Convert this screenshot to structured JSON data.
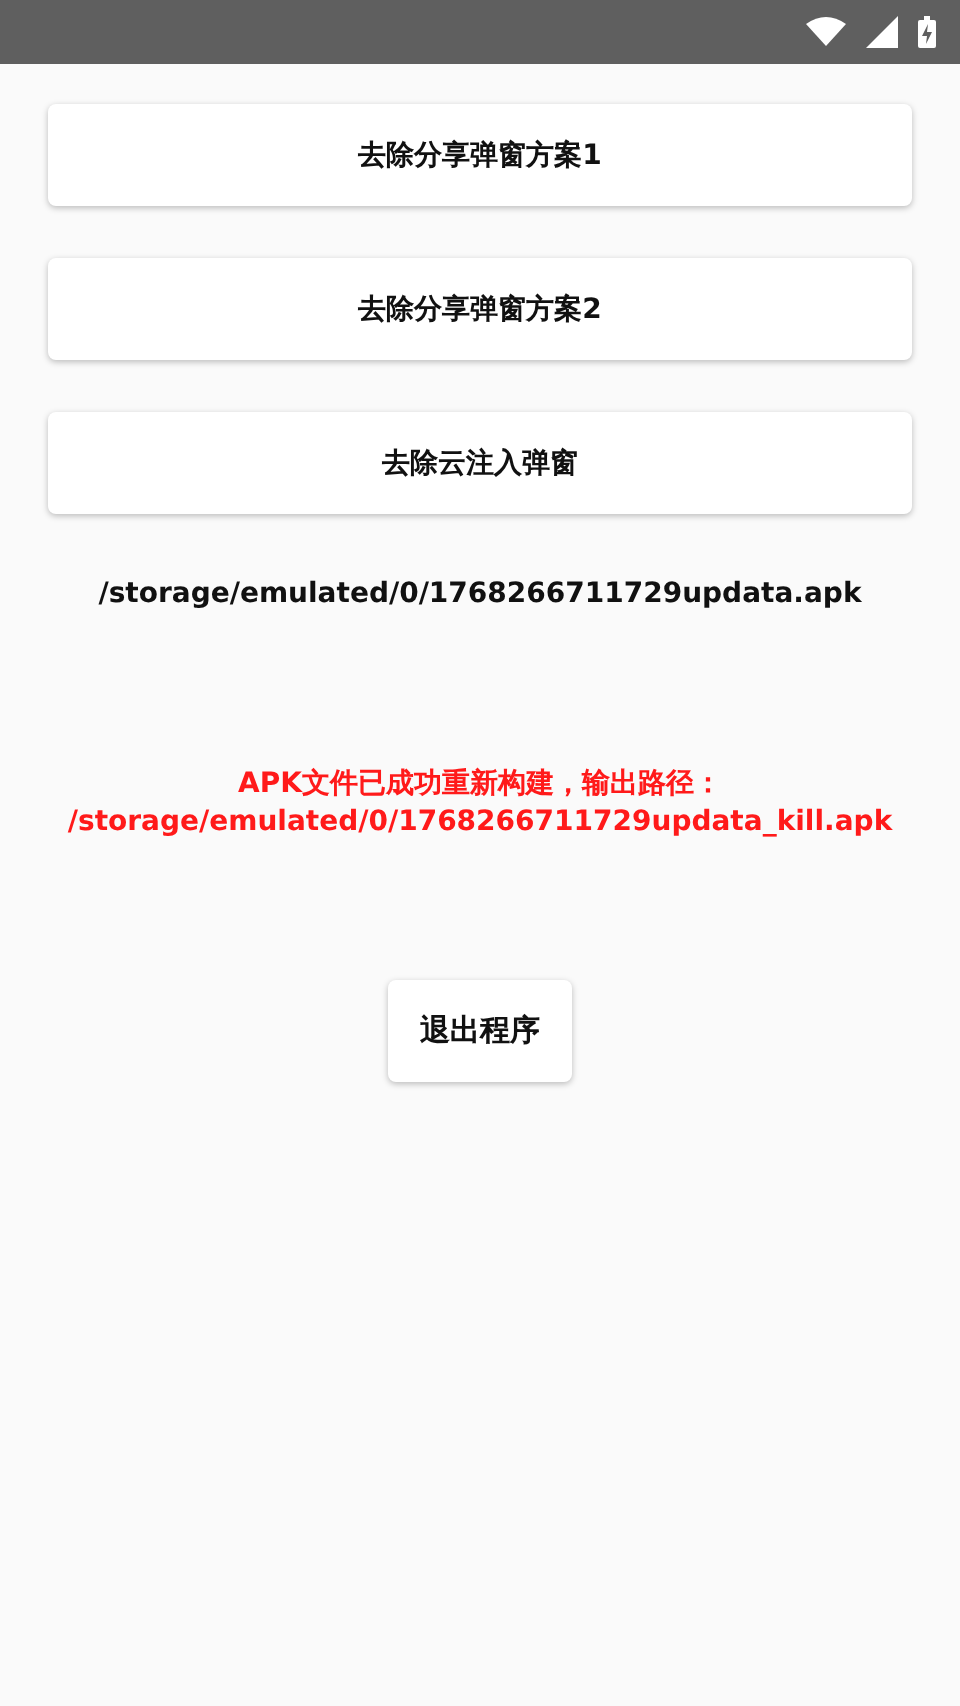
{
  "actions": [
    {
      "label": "去除分享弹窗方案1"
    },
    {
      "label": "去除分享弹窗方案2"
    },
    {
      "label": "去除云注入弹窗"
    }
  ],
  "selected_file": "/storage/emulated/0/1768266711729updata.apk",
  "result_message": [
    "APK文件已成功重新构建，输出路径：",
    "/storage/emulated/0/1768266711729updata_kill.apk"
  ],
  "exit_button": "退出程序"
}
